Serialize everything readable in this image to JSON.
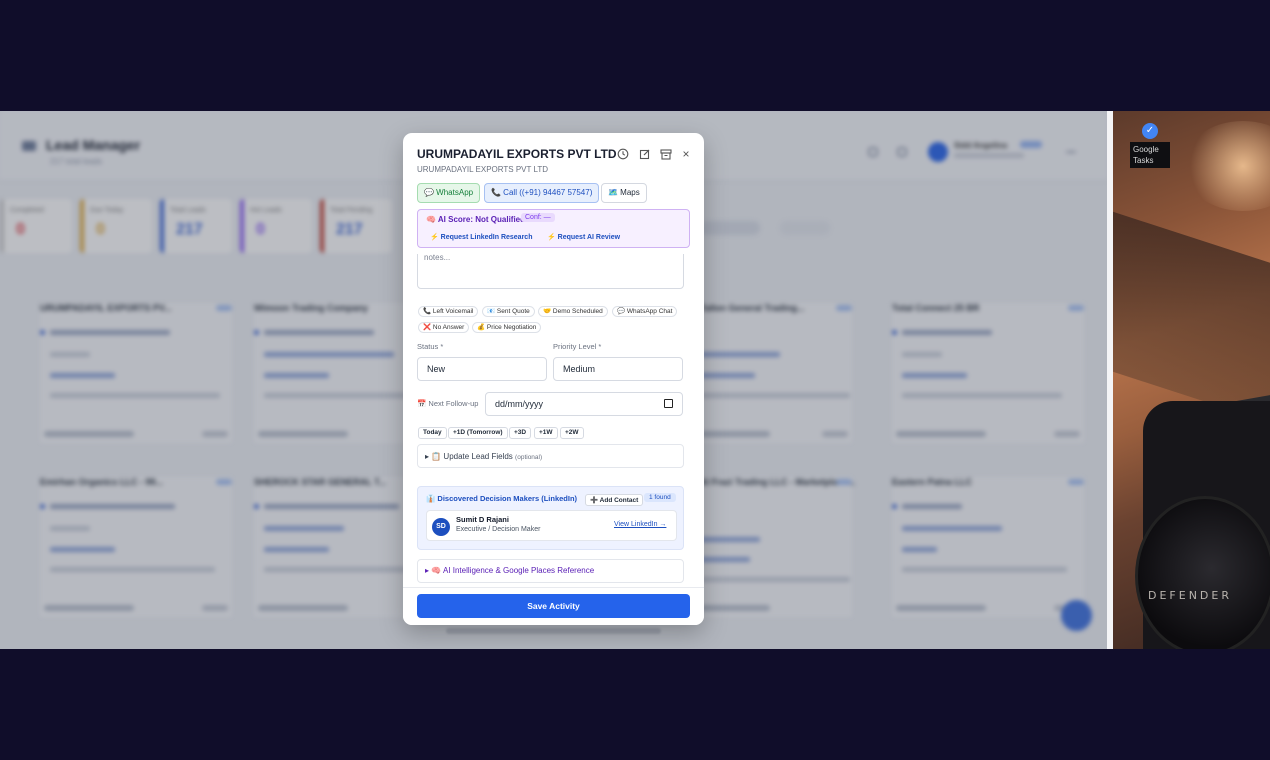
{
  "app": {
    "title": "Lead Manager",
    "subtitle": "217 total leads",
    "user": "Sidd Angelina",
    "stats": [
      {
        "label": "Completed",
        "value": "0",
        "color": "#e0424a"
      },
      {
        "label": "Due Today",
        "value": "0",
        "color": "#e0a93a"
      },
      {
        "label": "Total Leads",
        "value": "217",
        "color": "#3b66d8"
      },
      {
        "label": "Hot Leads",
        "value": "0",
        "color": "#8b5cf6"
      },
      {
        "label": "Total Pending",
        "value": "217",
        "color": "#c0392b"
      }
    ],
    "cards": [
      "URUMPADAYIL EXPORTS PV...",
      "Wimoon Trading Company",
      "Tallon General Trading...",
      "Total Connect 25 BR",
      "Emirhan Organics LLC - 99...",
      "SHEROCK STAR GENERAL T...",
      "Al Frazi Trading LLC - Marketplace...",
      "Eastern Patna LLC"
    ]
  },
  "photo": {
    "brand_text": "DEFENDER",
    "widget_label": "Google Tasks"
  },
  "modal": {
    "title": "URUMPADAYIL EXPORTS PVT LTD",
    "subtitle": "URUMPADAYIL EXPORTS PVT LTD",
    "actions": {
      "whatsapp": "💬 WhatsApp",
      "call": "📞 Call ((+91) 94467 57547)",
      "maps": "🗺️ Maps"
    },
    "ai": {
      "score": "🧠 AI Score: Not Qualified",
      "conf": "Conf: —",
      "linkedin": "⚡ Request LinkedIn Research",
      "review": "⚡ Request AI Review"
    },
    "notes_placeholder": "notes...",
    "quick_chips": [
      "📞 Left Voicemail",
      "📧 Sent Quote",
      "🤝 Demo Scheduled",
      "💬 WhatsApp Chat",
      "❌ No Answer",
      "💰 Price Negotiation"
    ],
    "status_label": "Status *",
    "status_value": "New",
    "priority_label": "Priority Level *",
    "priority_value": "Medium",
    "followup_label": "📅 Next Follow-up",
    "followup_value": "dd/mm/yyyy",
    "date_chips": [
      "Today",
      "+1D (Tomorrow)",
      "+3D",
      "+1W",
      "+2W"
    ],
    "update_fields": "▸ 📋 Update Lead Fields",
    "update_fields_opt": "(optional)",
    "decision_makers": {
      "title": "👔 Discovered Decision Makers (LinkedIn)",
      "add_contact": "➕ Add Contact",
      "found": "1 found",
      "person": {
        "initials": "SD",
        "name": "Sumit D Rajani",
        "role": "Executive / Decision Maker",
        "link": "View LinkedIn →"
      }
    },
    "ai_ref": "▸ 🧠 AI Intelligence & Google Places Reference",
    "save": "Save Activity"
  }
}
